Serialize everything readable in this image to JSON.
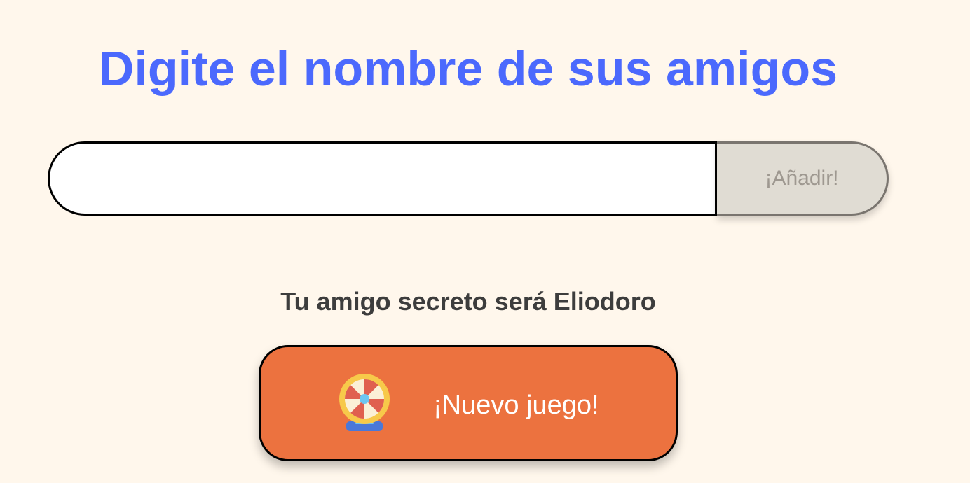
{
  "header": {
    "title": "Digite el nombre de sus amigos"
  },
  "form": {
    "input_value": "",
    "input_placeholder": "",
    "add_button_label": "¡Añadir!"
  },
  "result": {
    "text": "Tu amigo secreto será Eliodoro"
  },
  "new_game": {
    "label": "¡Nuevo juego!",
    "icon": "prize-wheel-icon"
  },
  "colors": {
    "background": "#fff7ec",
    "title": "#4b69fd",
    "add_button_bg": "#e0dcd3",
    "new_game_bg": "#ec723f"
  }
}
